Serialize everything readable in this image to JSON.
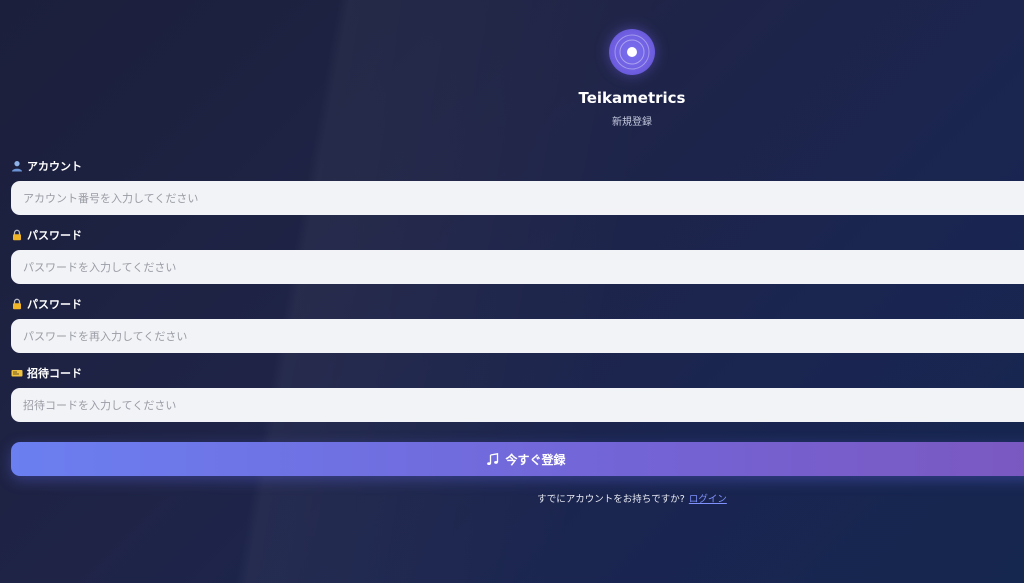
{
  "brand": {
    "name": "Teikametrics",
    "subtitle": "新規登録"
  },
  "form": {
    "account": {
      "label": "アカウント",
      "placeholder": "アカウント番号を入力してください",
      "icon": "user-icon"
    },
    "password": {
      "label": "パスワード",
      "placeholder": "パスワードを入力してください",
      "icon": "lock-icon"
    },
    "password_confirm": {
      "label": "パスワード",
      "placeholder": "パスワードを再入力してください",
      "icon": "lock-icon"
    },
    "invite_code": {
      "label": "招待コード",
      "placeholder": "招待コードを入力してください",
      "icon": "ticket-icon"
    },
    "submit_label": "今すぐ登録",
    "submit_icon": "music-note-icon"
  },
  "footer": {
    "prompt": "すでにアカウントをお持ちですか?",
    "login_link": "ログイン"
  },
  "colors": {
    "accent": "#6b7ff0",
    "link": "#7f92ff",
    "background": "#1f2447"
  }
}
